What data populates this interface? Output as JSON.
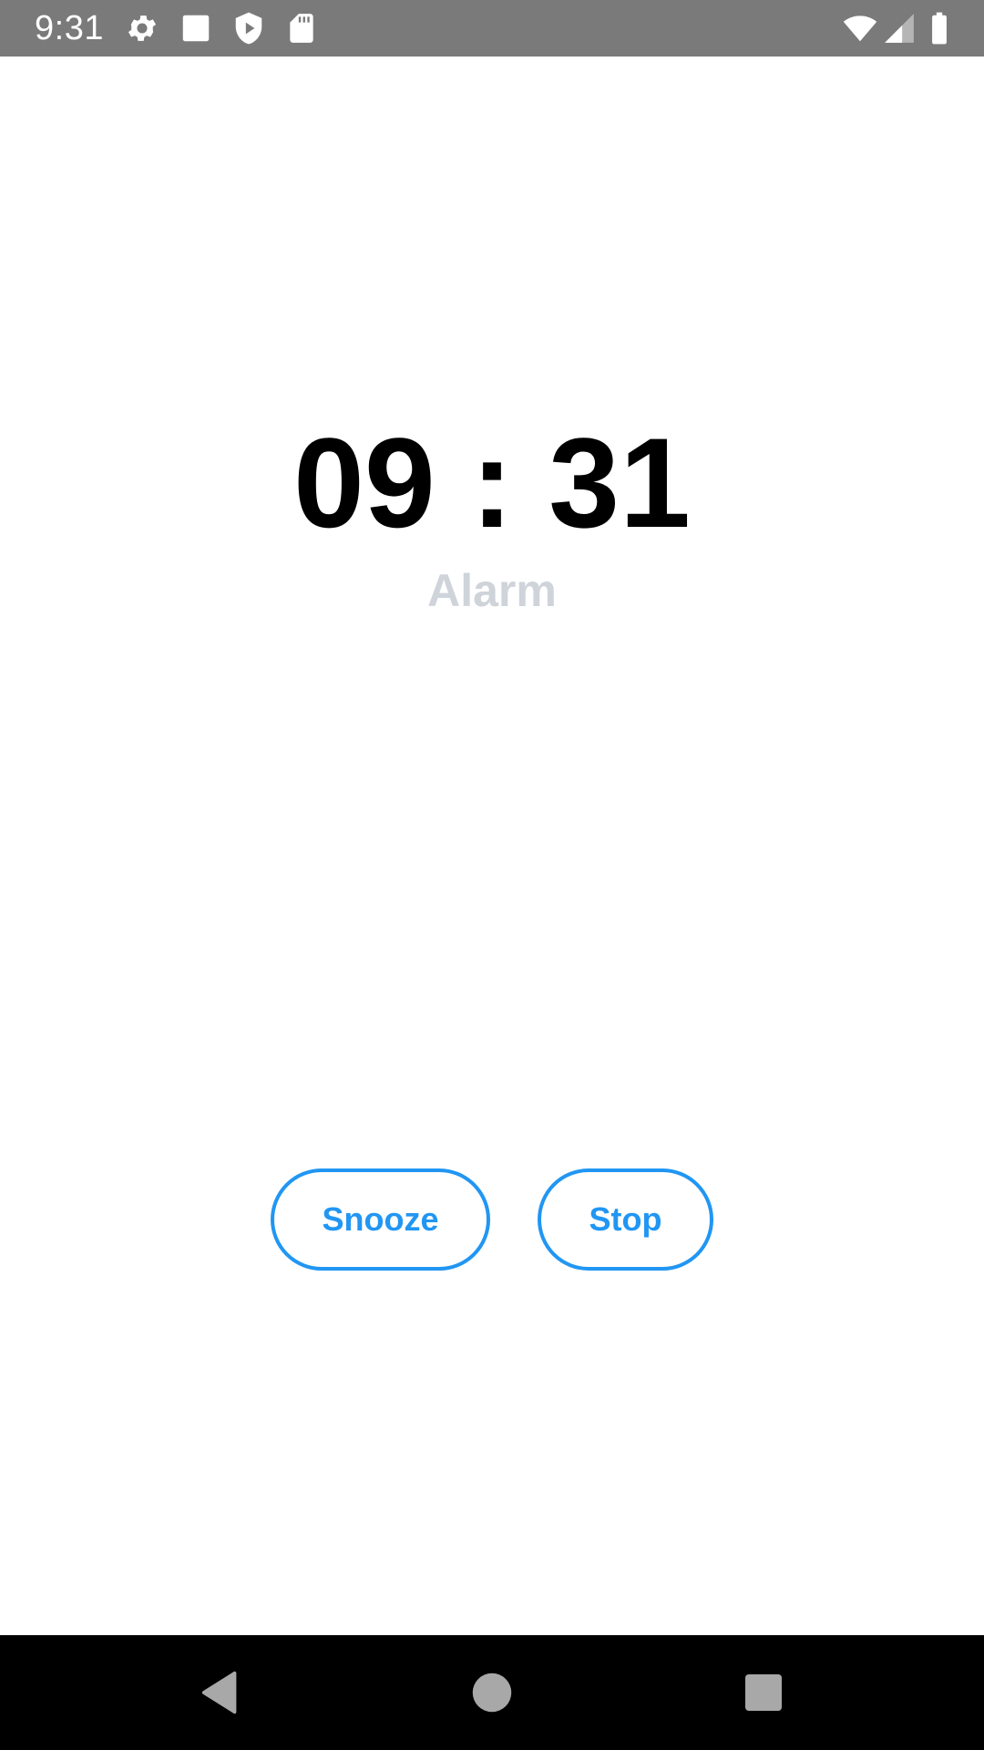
{
  "status_bar": {
    "time": "9:31",
    "background": "#7a7a7a",
    "left_icons": [
      "gear-icon",
      "square-notification-icon",
      "shield-play-icon",
      "sd-card-icon"
    ],
    "right_icons": [
      "wifi-icon",
      "cell-signal-icon",
      "battery-icon"
    ]
  },
  "alarm": {
    "time": "09 : 31",
    "label": "Alarm"
  },
  "buttons": {
    "snooze_label": "Snooze",
    "stop_label": "Stop",
    "accent_color": "#2196f3"
  },
  "nav_bar": {
    "back_icon": "back-triangle-icon",
    "home_icon": "home-circle-icon",
    "recents_icon": "recents-square-icon"
  }
}
